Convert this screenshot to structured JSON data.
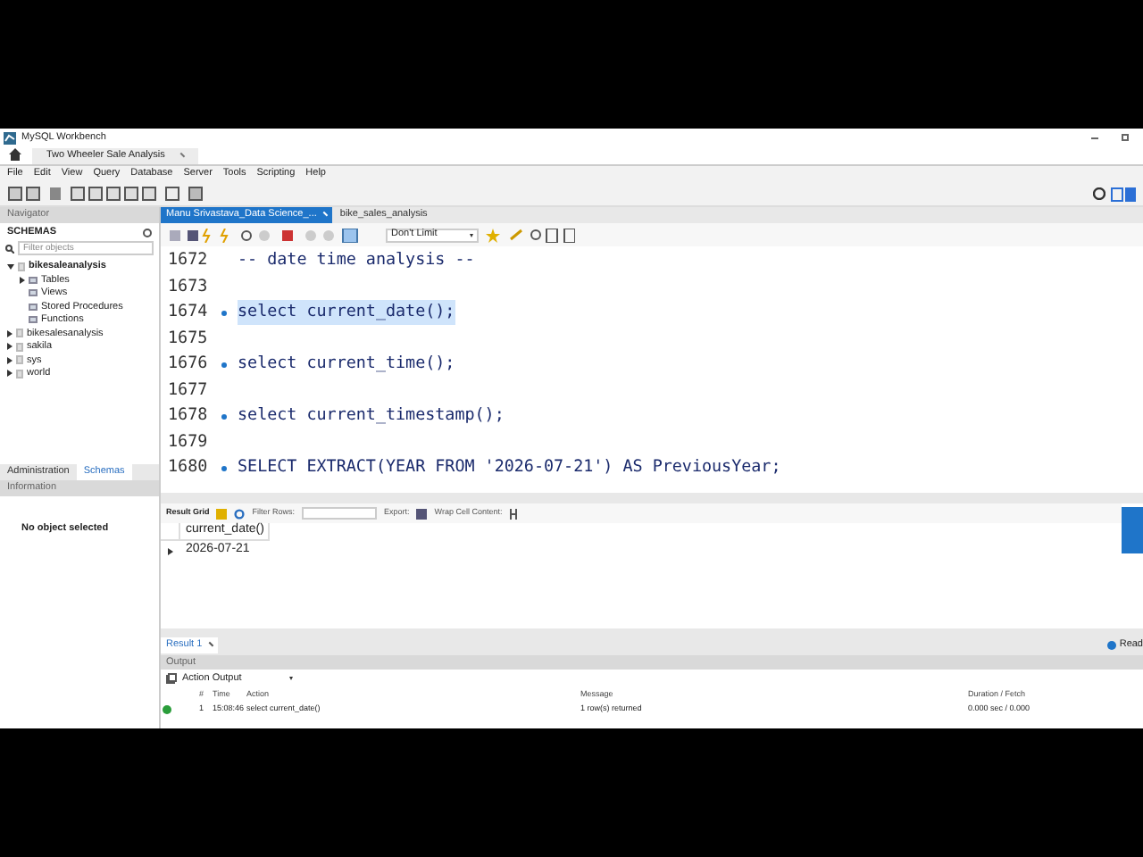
{
  "window": {
    "title": "MySQL Workbench"
  },
  "connection_tabs": [
    {
      "label": "Two Wheeler Sale Analysis",
      "selected": true
    }
  ],
  "menu": [
    "File",
    "Edit",
    "View",
    "Query",
    "Database",
    "Server",
    "Tools",
    "Scripting",
    "Help"
  ],
  "navigator": {
    "header": "Navigator",
    "section": "SCHEMAS",
    "filter_placeholder": "Filter objects",
    "tree": [
      {
        "label": "bikesaleanalysis",
        "expanded": true,
        "bold": true,
        "children": [
          {
            "label": "Tables",
            "expandable": true
          },
          {
            "label": "Views",
            "expandable": false
          },
          {
            "label": "Stored Procedures",
            "expandable": false
          },
          {
            "label": "Functions",
            "expandable": false
          }
        ]
      },
      {
        "label": "bikesalesanalysis",
        "expanded": false,
        "bold": false
      },
      {
        "label": "sakila",
        "expanded": false,
        "bold": false
      },
      {
        "label": "sys",
        "expanded": false,
        "bold": false
      },
      {
        "label": "world",
        "expanded": false,
        "bold": false
      }
    ],
    "tabs": [
      {
        "label": "Administration",
        "selected": false
      },
      {
        "label": "Schemas",
        "selected": true
      }
    ],
    "information_header": "Information",
    "information_text": "No object selected"
  },
  "editor_tabs": [
    {
      "label": "Manu Srivastava_Data Science_...",
      "selected": true,
      "closable": true
    },
    {
      "label": "bike_sales_analysis",
      "selected": false,
      "closable": false
    }
  ],
  "limit_dropdown": "Don't Limit",
  "code_lines": [
    {
      "number": "1672",
      "text": "-- date time analysis --",
      "statement": false,
      "selected": false
    },
    {
      "number": "1673",
      "statement": false,
      "selected": false
    },
    {
      "number": "1674",
      "text": "select current_date();",
      "statement": true,
      "selected": true
    },
    {
      "number": "1675",
      "statement": false,
      "selected": false
    },
    {
      "number": "1676",
      "text": "select current_time();",
      "statement": true,
      "selected": false
    },
    {
      "number": "1677",
      "statement": false,
      "selected": false
    },
    {
      "number": "1678",
      "text": "select current_timestamp();",
      "statement": true,
      "selected": false
    },
    {
      "number": "1679",
      "statement": false,
      "selected": false
    },
    {
      "number": "1680",
      "text": "SELECT EXTRACT(YEAR FROM '2026-07-21') AS PreviousYear;",
      "statement": true,
      "selected": false
    }
  ],
  "result_toolbar": {
    "grid_label": "Result Grid",
    "filter_label": "Filter Rows:",
    "export_label": "Export:",
    "wrap_label": "Wrap Cell Content:"
  },
  "result_grid": {
    "columns": [
      "current_date()"
    ],
    "rows": [
      [
        "2026-07-21"
      ]
    ]
  },
  "result_tabs": [
    {
      "label": "Result 1",
      "selected": true
    }
  ],
  "side_label": "Read",
  "output": {
    "header": "Output",
    "dropdown": "Action Output",
    "columns": [
      "#",
      "Time",
      "Action",
      "Message",
      "Duration / Fetch"
    ],
    "rows": [
      {
        "success": true,
        "cells": [
          "1",
          "15:08:46",
          "select current_date()",
          "1 row(s) returned",
          "0.000 sec / 0.000"
        ]
      }
    ]
  }
}
